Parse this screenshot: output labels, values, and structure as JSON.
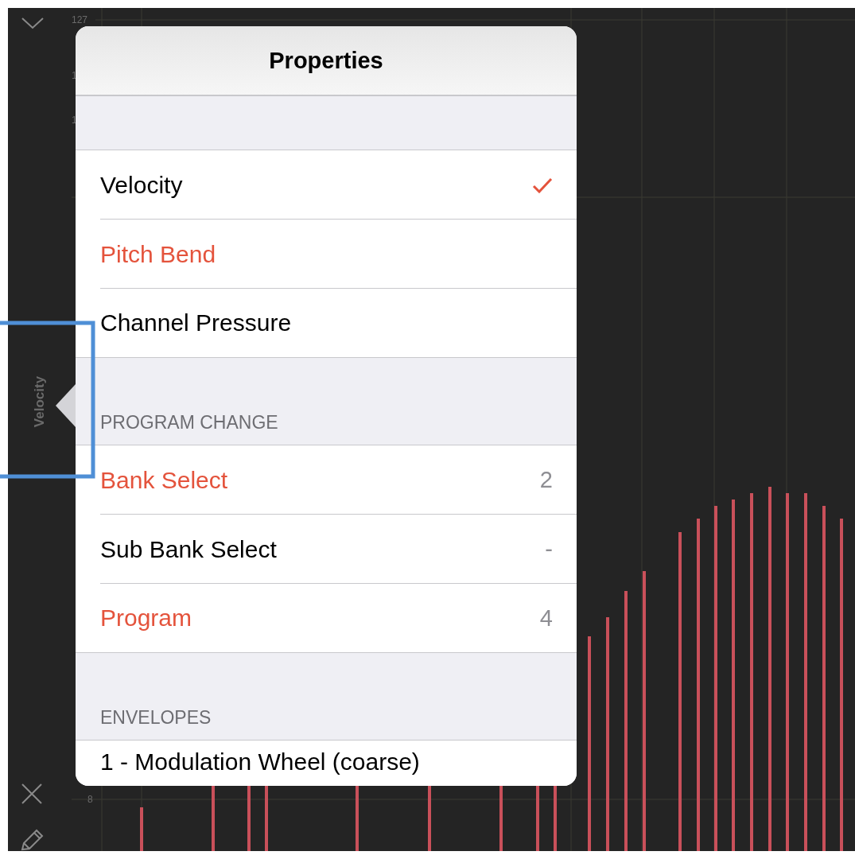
{
  "sidebar": {
    "label": "Velocity"
  },
  "axis_labels": [
    {
      "text": "127",
      "kind": "top"
    },
    {
      "text": "1",
      "kind": "upper"
    },
    {
      "text": "1",
      "kind": "middle"
    },
    {
      "text": "8",
      "kind": "low"
    }
  ],
  "popover": {
    "title": "Properties",
    "sections": [
      {
        "items": [
          {
            "label": "Velocity",
            "checked": true,
            "active": false
          },
          {
            "label": "Pitch Bend",
            "checked": false,
            "active": true
          },
          {
            "label": "Channel Pressure",
            "checked": false,
            "active": false
          }
        ]
      },
      {
        "header": "PROGRAM CHANGE",
        "items": [
          {
            "label": "Bank Select",
            "value": "2",
            "checked": false,
            "active": true
          },
          {
            "label": "Sub Bank Select",
            "value": "-",
            "checked": false,
            "active": false
          },
          {
            "label": "Program",
            "value": "4",
            "checked": false,
            "active": true
          }
        ]
      },
      {
        "header": "ENVELOPES",
        "items": [
          {
            "label": "1 - Modulation Wheel (coarse)",
            "checked": false,
            "active": false
          }
        ]
      }
    ]
  }
}
